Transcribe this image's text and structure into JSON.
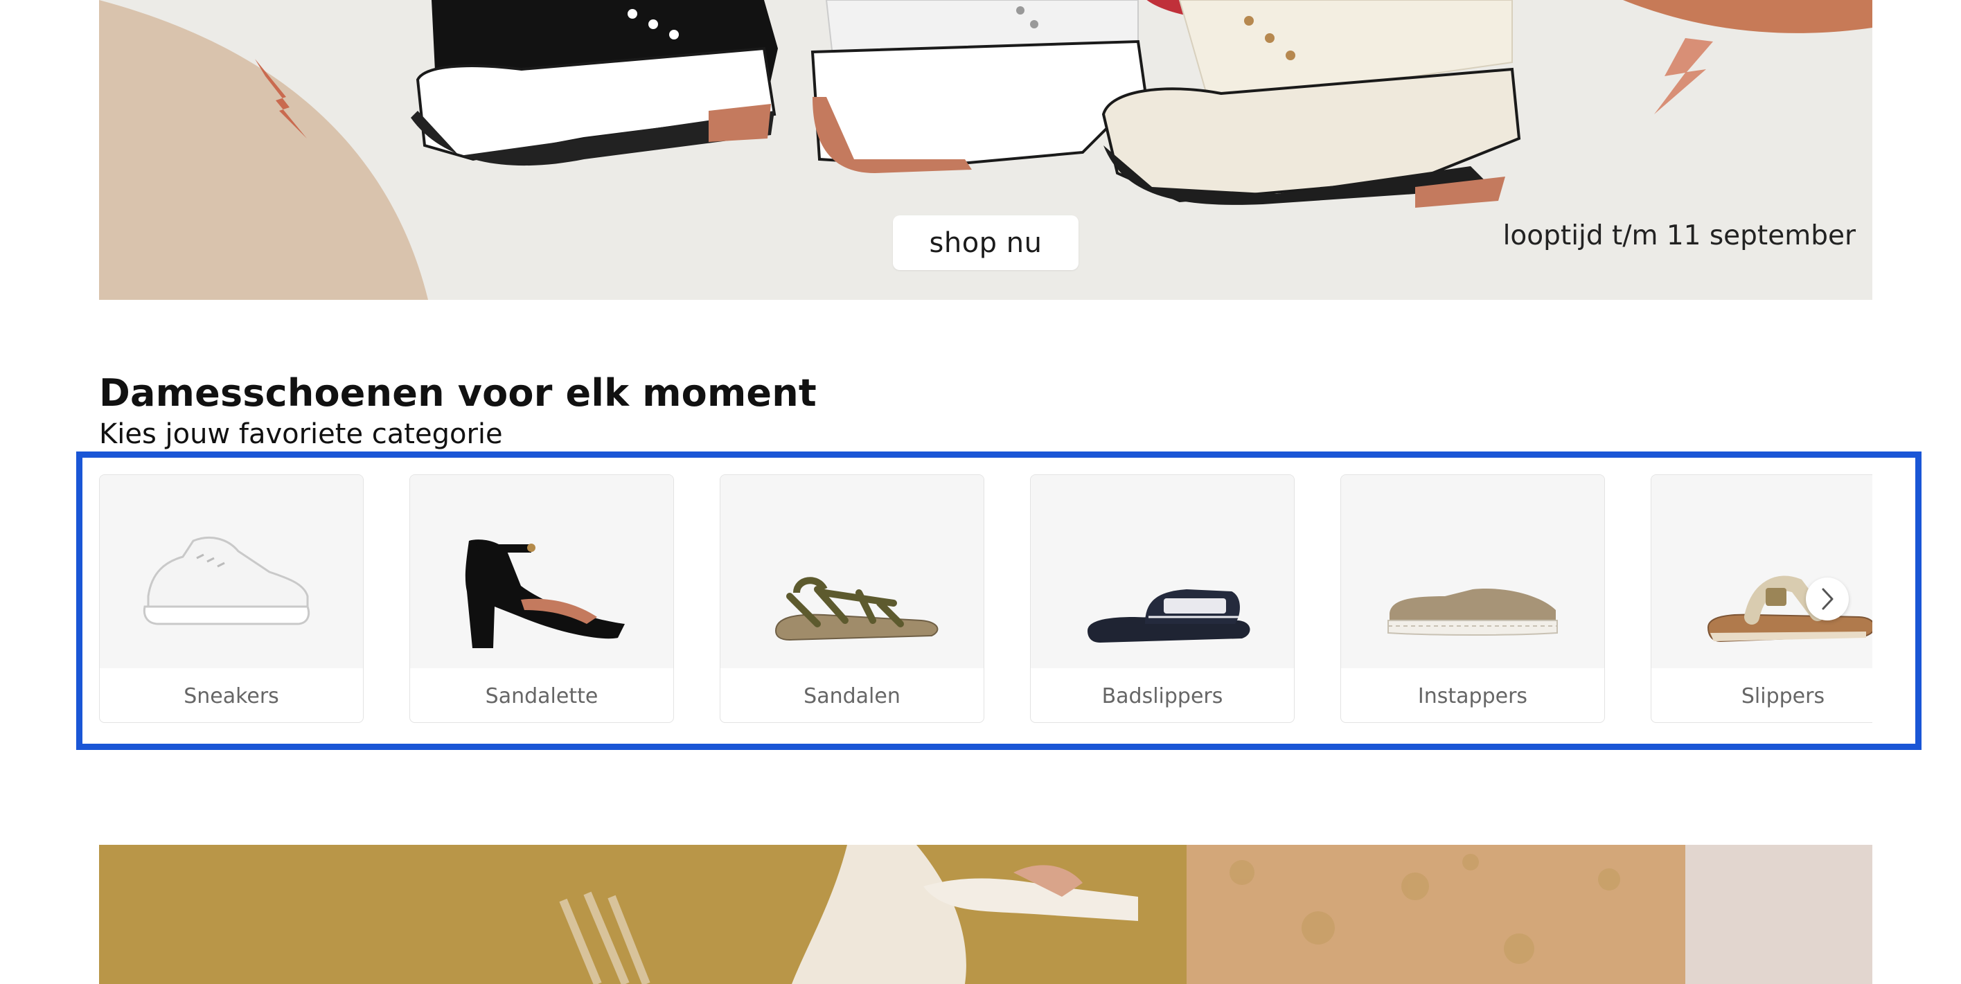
{
  "hero": {
    "cta_label": "shop nu",
    "runtime_text": "looptijd t/m 11 september"
  },
  "section": {
    "title": "Damesschoenen voor elk moment",
    "subtitle": "Kies jouw favoriete categorie"
  },
  "categories": [
    {
      "label": "Sneakers",
      "icon": "sneaker-image"
    },
    {
      "label": "Sandalette",
      "icon": "block-heel-sandal-image"
    },
    {
      "label": "Sandalen",
      "icon": "flat-sandal-image"
    },
    {
      "label": "Badslippers",
      "icon": "slide-image"
    },
    {
      "label": "Instappers",
      "icon": "espadrille-image"
    },
    {
      "label": "Slippers",
      "icon": "flip-flop-image"
    }
  ],
  "carousel": {
    "next_icon": "chevron-right-icon"
  },
  "colors": {
    "highlight": "#1a56d6",
    "hero_background": "#ecebe7",
    "card_image_background": "#f6f6f6",
    "card_label_text": "#666666"
  }
}
